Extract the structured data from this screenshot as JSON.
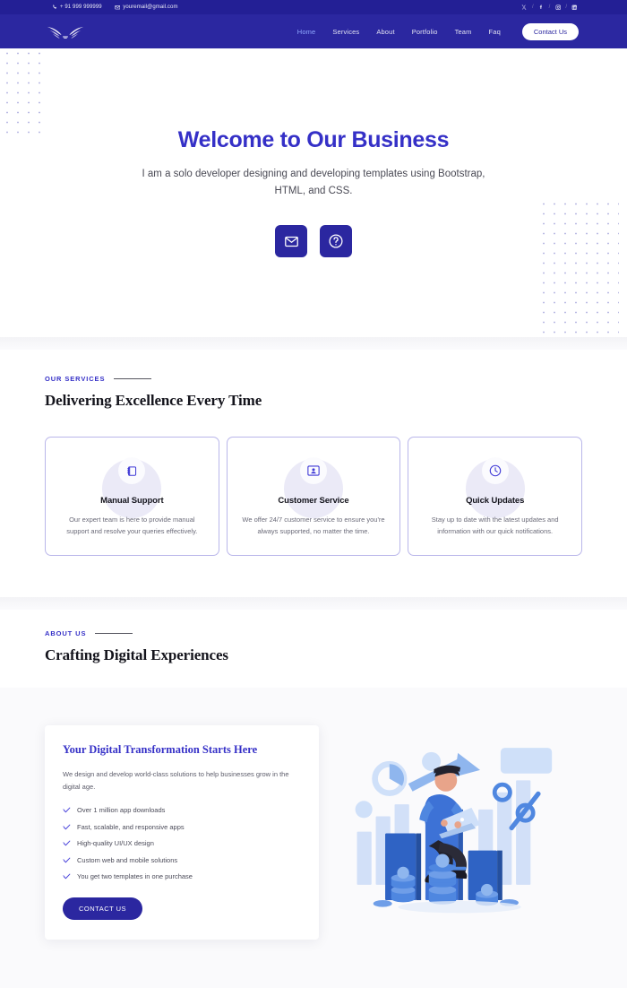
{
  "topbar": {
    "phone": "+ 91 999 999999",
    "email": "youremail@gmail.com",
    "phone_icon": "phone-icon",
    "email_icon": "envelope-icon",
    "separator": "/",
    "socials": [
      {
        "name": "x-twitter-icon",
        "label": "X"
      },
      {
        "name": "facebook-icon",
        "label": "f"
      },
      {
        "name": "instagram-icon",
        "label": "IG"
      },
      {
        "name": "linkedin-icon",
        "label": "in"
      }
    ]
  },
  "nav": {
    "logo_name": "wings-logo",
    "links": [
      {
        "label": "Home",
        "active": true
      },
      {
        "label": "Services",
        "active": false
      },
      {
        "label": "About",
        "active": false
      },
      {
        "label": "Portfolio",
        "active": false
      },
      {
        "label": "Team",
        "active": false
      },
      {
        "label": "Faq",
        "active": false
      }
    ],
    "cta_label": "Contact Us"
  },
  "hero": {
    "title": "Welcome to Our Business",
    "subtitle": "I am a solo developer designing and developing templates using Bootstrap, HTML, and CSS.",
    "buttons": [
      {
        "name": "email-button",
        "icon": "envelope-icon"
      },
      {
        "name": "help-button",
        "icon": "question-circle-icon"
      }
    ]
  },
  "services": {
    "eyebrow": "OUR SERVICES",
    "title": "Delivering Excellence Every Time",
    "cards": [
      {
        "icon": "notebook-icon",
        "title": "Manual Support",
        "text": "Our expert team is here to provide manual support and resolve your queries effectively."
      },
      {
        "icon": "user-frame-icon",
        "title": "Customer Service",
        "text": "We offer 24/7 customer service to ensure you're always supported, no matter the time."
      },
      {
        "icon": "clock-icon",
        "title": "Quick Updates",
        "text": "Stay up to date with the latest updates and information with our quick notifications."
      }
    ]
  },
  "about": {
    "eyebrow": "ABOUT US",
    "title": "Crafting Digital Experiences",
    "card_title": "Your Digital Transformation Starts Here",
    "card_text": "We design and develop world-class solutions to help businesses grow in the digital age.",
    "bullets": [
      "Over 1 million app downloads",
      "Fast, scalable, and responsive apps",
      "High-quality UI/UX design",
      "Custom web and mobile solutions",
      "You get two templates in one purchase"
    ],
    "cta_label": "CONTACT US",
    "illustration_name": "business-growth-illustration"
  },
  "colors": {
    "brand_dark": "#2b27a0",
    "brand_topbar": "#231f95",
    "accent": "#3530c7",
    "nav_active": "#8fa8ff",
    "card_border": "#b9b6ea",
    "section_bg": "#fafafc"
  }
}
